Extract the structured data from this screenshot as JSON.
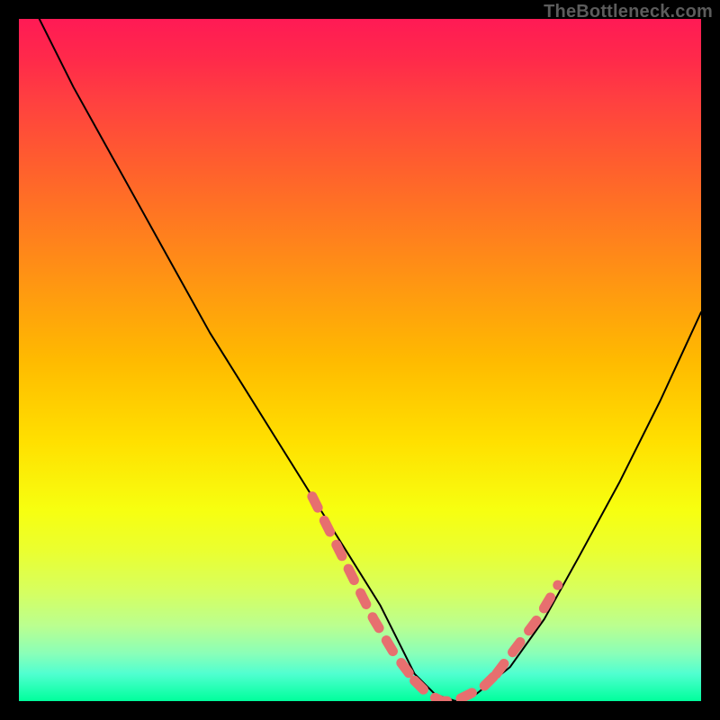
{
  "watermark": "TheBottleneck.com",
  "chart_data": {
    "type": "line",
    "title": "",
    "xlabel": "",
    "ylabel": "",
    "xlim": [
      0,
      100
    ],
    "ylim": [
      0,
      100
    ],
    "grid": false,
    "background_gradient": [
      "#ff1a55",
      "#ffba00",
      "#f7ff10",
      "#00ff9c"
    ],
    "series": [
      {
        "name": "bottleneck-curve",
        "stroke": "#000000",
        "x": [
          3,
          8,
          13,
          18,
          23,
          28,
          33,
          38,
          43,
          48,
          53,
          56,
          58,
          61,
          64,
          67,
          72,
          77,
          82,
          88,
          94,
          100
        ],
        "y": [
          100,
          90,
          81,
          72,
          63,
          54,
          46,
          38,
          30,
          22,
          14,
          8,
          4,
          1,
          0,
          1,
          5,
          12,
          21,
          32,
          44,
          57
        ]
      },
      {
        "name": "highlight-band-left",
        "stroke": "#e76f6f",
        "dashed": true,
        "x": [
          43,
          46,
          49,
          52,
          55,
          58
        ],
        "y": [
          30,
          24,
          18,
          12,
          7,
          3
        ]
      },
      {
        "name": "highlight-band-bottom",
        "stroke": "#e76f6f",
        "dashed": true,
        "x": [
          58,
          60,
          62,
          64,
          66,
          68,
          70
        ],
        "y": [
          3,
          1,
          0,
          0,
          1,
          2,
          4
        ]
      },
      {
        "name": "highlight-band-right",
        "stroke": "#e76f6f",
        "dashed": true,
        "x": [
          70,
          73,
          76,
          79
        ],
        "y": [
          4,
          8,
          12,
          17
        ]
      }
    ],
    "annotations": []
  }
}
